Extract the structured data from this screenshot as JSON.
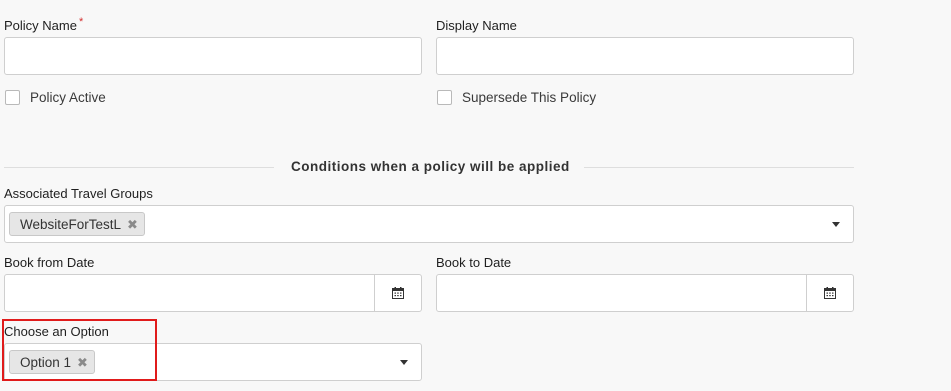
{
  "policy_name": {
    "label": "Policy Name",
    "required_mark": "*",
    "value": ""
  },
  "display_name": {
    "label": "Display Name",
    "value": ""
  },
  "policy_active": {
    "label": "Policy Active",
    "checked": false
  },
  "supersede_policy": {
    "label": "Supersede This Policy",
    "checked": false
  },
  "conditions_section": {
    "title": "Conditions when a policy will be applied"
  },
  "travel_groups": {
    "label": "Associated Travel Groups",
    "tags": [
      {
        "text": "WebsiteForTestL",
        "remove": "✖"
      }
    ]
  },
  "book_from": {
    "label": "Book from Date",
    "value": "",
    "icon": "calendar-icon"
  },
  "book_to": {
    "label": "Book to Date",
    "value": "",
    "icon": "calendar-icon"
  },
  "choose_option": {
    "label": "Choose an Option",
    "tags": [
      {
        "text": "Option 1",
        "remove": "✖"
      }
    ]
  },
  "colors": {
    "background": "#f8f8f8",
    "field_border": "#cfcfcf",
    "required": "#d32f2f",
    "highlight": "#e01b1b",
    "tag_bg": "#e6e6e6"
  }
}
